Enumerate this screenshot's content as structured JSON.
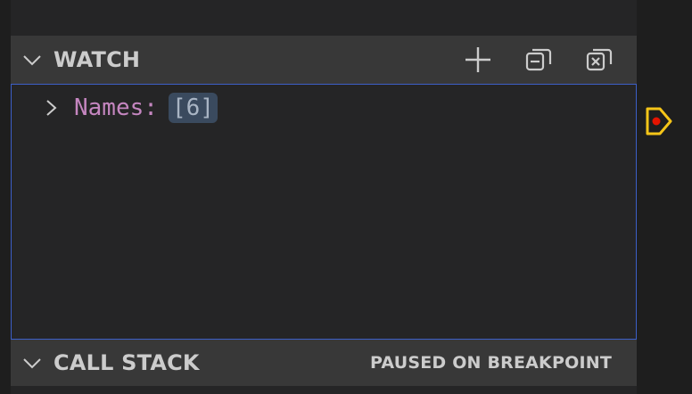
{
  "watch": {
    "title": "WATCH",
    "actions": {
      "add": "plus-icon",
      "collapse_all": "collapse-all-icon",
      "remove_all": "close-all-icon"
    },
    "items": [
      {
        "name": "Names",
        "colon": ":",
        "value": "[6]"
      }
    ]
  },
  "call_stack": {
    "title": "CALL STACK",
    "status": "PAUSED ON BREAKPOINT"
  },
  "colors": {
    "header_bg": "#383838",
    "panel_bg": "#252526",
    "focus_border": "#3c5fc8",
    "name_color": "#c586c0",
    "value_badge_bg": "#3a4a5e",
    "breakpoint_yellow": "#f5c518",
    "breakpoint_red": "#e51400"
  }
}
